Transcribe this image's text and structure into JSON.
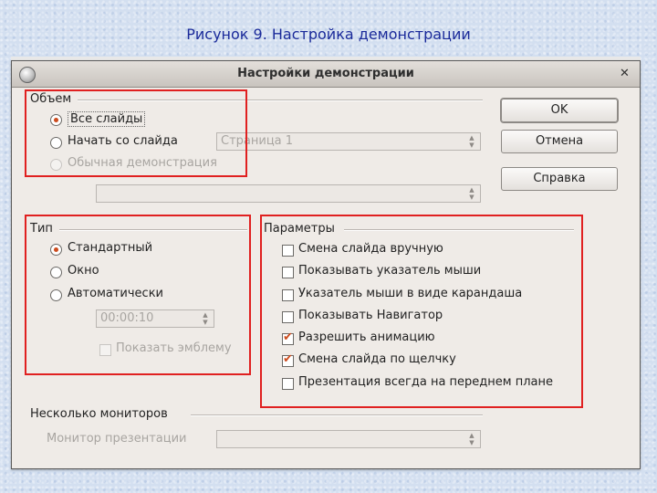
{
  "slide_title": "Рисунок 9. Настройка демонстрации",
  "dialog": {
    "title": "Настройки демонстрации",
    "close_icon": "close-icon"
  },
  "range": {
    "heading": "Объем",
    "all_slides": "Все слайды",
    "from_slide": "Начать со слайда",
    "from_slide_value": "Страница 1",
    "custom_show": "Обычная демонстрация",
    "custom_show_value": ""
  },
  "type": {
    "heading": "Тип",
    "standard": "Стандартный",
    "window": "Окно",
    "auto": "Автоматически",
    "pause_value": "00:00:10",
    "show_logo": "Показать эмблему"
  },
  "options": {
    "heading": "Параметры",
    "items": [
      {
        "label": "Смена слайда вручную",
        "checked": false
      },
      {
        "label": "Показывать указатель мыши",
        "checked": false
      },
      {
        "label": "Указатель мыши в виде карандаша",
        "checked": false
      },
      {
        "label": "Показывать Навигатор",
        "checked": false
      },
      {
        "label": "Разрешить анимацию",
        "checked": true
      },
      {
        "label": "Смена слайда по щелчку",
        "checked": true
      },
      {
        "label": "Презентация всегда на переднем плане",
        "checked": false
      }
    ]
  },
  "monitors": {
    "heading": "Несколько мониторов",
    "label": "Монитор презентации",
    "value": ""
  },
  "buttons": {
    "ok": "OK",
    "cancel": "Отмена",
    "help": "Справка"
  },
  "colors": {
    "highlight_box": "#e02020",
    "radio_check_accent": "#cc4b1d",
    "title_text": "#1a2a9a"
  }
}
